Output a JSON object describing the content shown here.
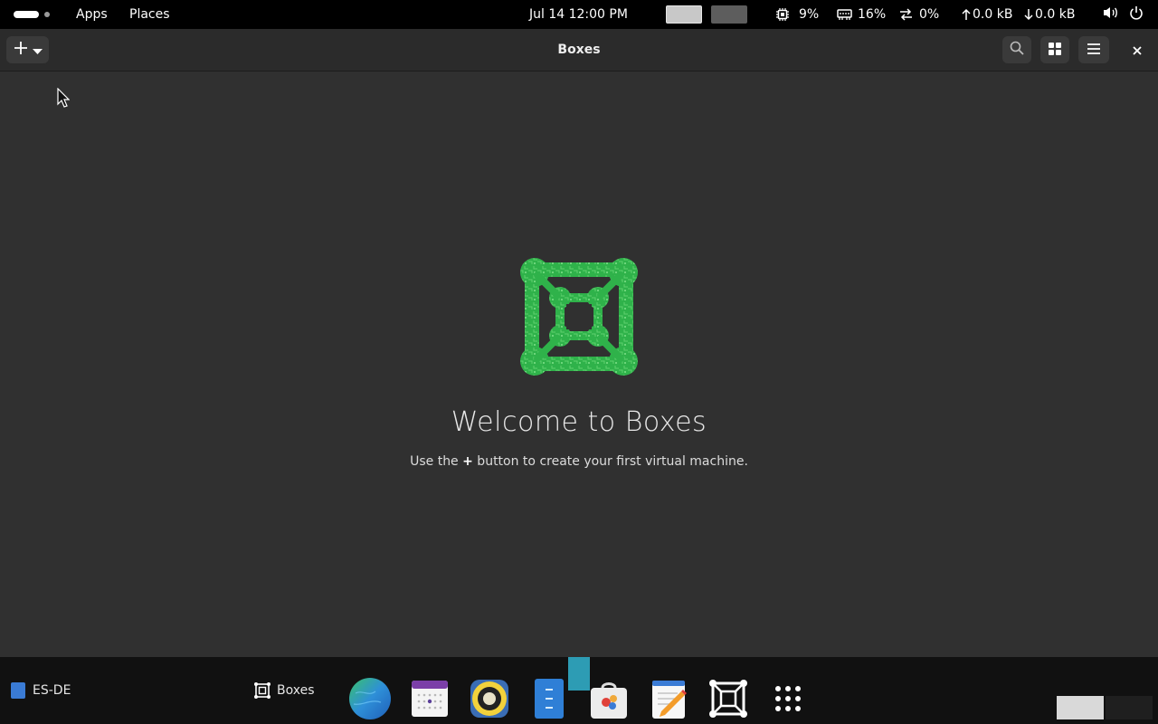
{
  "topbar": {
    "apps_label": "Apps",
    "places_label": "Places",
    "clock": "Jul 14  12:00 PM",
    "cpu": "9%",
    "memory": "16%",
    "swap": "0%",
    "upload": "0.0 kB",
    "download": "0.0 kB",
    "icons": [
      "activities-pill-icon",
      "cpu-icon",
      "memory-icon",
      "swap-icon",
      "arrow-up-icon",
      "arrow-down-icon",
      "volume-icon",
      "power-icon"
    ]
  },
  "window": {
    "title": "Boxes",
    "buttons": [
      "add-icon",
      "search-icon",
      "grid-view-icon",
      "menu-icon",
      "close-icon"
    ]
  },
  "welcome": {
    "title": "Welcome to Boxes",
    "sub_before": "Use the ",
    "sub_plus": "+",
    "sub_after": " button to create your first virtual machine."
  },
  "dock": {
    "es_de_label": "ES-DE",
    "boxes_label": "Boxes",
    "apps": [
      "web-browser-icon",
      "calendar-icon",
      "music-player-icon",
      "file-manager-icon",
      "software-store-icon",
      "text-editor-icon",
      "boxes-app-icon",
      "show-apps-icon"
    ]
  },
  "colors": {
    "logo_green": "#2fb24a",
    "topbar_bg": "#000000",
    "window_bg": "#303030",
    "dock_bg": "#111111"
  }
}
